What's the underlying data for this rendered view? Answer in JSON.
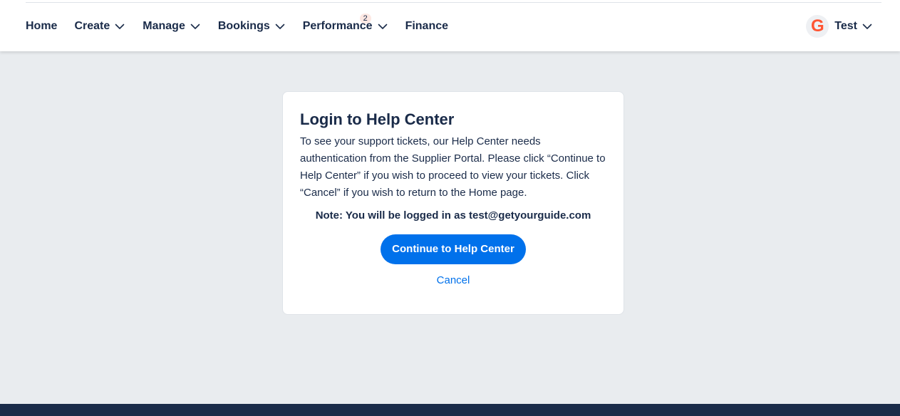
{
  "nav": {
    "items": [
      {
        "label": "Home",
        "has_dropdown": false
      },
      {
        "label": "Create",
        "has_dropdown": true
      },
      {
        "label": "Manage",
        "has_dropdown": true
      },
      {
        "label": "Bookings",
        "has_dropdown": true
      },
      {
        "label": "Performance",
        "has_dropdown": true,
        "badge": "2"
      },
      {
        "label": "Finance",
        "has_dropdown": false
      }
    ]
  },
  "user": {
    "avatar_letter": "G",
    "name": "Test",
    "has_dropdown": true
  },
  "dialog": {
    "title": "Login to Help Center",
    "body": "To see your support tickets, our Help Center needs authentication from the Supplier Portal. Please click “Continue to Help Center” if you wish to proceed to view your tickets. Click “Cancel” if you wish to return to the Home page.",
    "note": "Note: You will be logged in as test@getyourguide.com",
    "continue_label": "Continue to Help Center",
    "cancel_label": "Cancel"
  },
  "colors": {
    "brand_blue": "#0071eb",
    "text_navy": "#1a2b49",
    "background": "#e9ecef",
    "logo_orange": "#ff5533",
    "badge_bg": "#fde8e3",
    "footer": "#1a2b49"
  },
  "icons": {
    "dropdown": "chevron-down-icon",
    "avatar": "getyourguide-logo-icon"
  }
}
